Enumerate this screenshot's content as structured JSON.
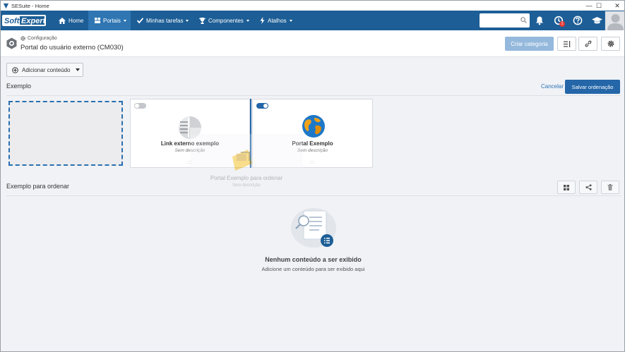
{
  "window": {
    "title": "SESuite - Home",
    "minimize": "—",
    "maximize": "☐",
    "close": "✕"
  },
  "nav": {
    "logo_text_1": "Soft",
    "logo_text_2": "Expert",
    "items": [
      {
        "label": "Home",
        "icon": "home-icon"
      },
      {
        "label": "Portais",
        "icon": "portals-icon"
      },
      {
        "label": "Minhas tarefas",
        "icon": "check-icon"
      },
      {
        "label": "Componentes",
        "icon": "trophy-icon"
      },
      {
        "label": "Atalhos",
        "icon": "bolt-icon"
      }
    ],
    "search_placeholder": "",
    "notification_badge": "1"
  },
  "header": {
    "breadcrumb": "Configuração",
    "title": "Portal do usuário externo (CM030)",
    "create_category": "Criar categoria"
  },
  "content": {
    "add_content": "Adicionar conteúdo",
    "section1_title": "Exemplo",
    "cancel": "Cancelar",
    "save_order": "Salvar ordenação",
    "cards": [
      {
        "title": "Link externo exemplo",
        "desc": "Sem descrição",
        "handle": ":::",
        "enabled": false
      },
      {
        "title": "Portal Exemplo",
        "desc": "Sem descrição",
        "handle": ":::",
        "enabled": true
      }
    ],
    "ghost": {
      "title": "Portal Exemplo para ordenar",
      "desc": "Sem descrição"
    },
    "section2_title": "Exemplo para ordenar",
    "empty_title": "Nenhum conteúdo a ser exibido",
    "empty_sub": "Adicione um conteúdo para ser exibido aqui"
  },
  "colors": {
    "navbar": "#1d5e96",
    "nav_active": "#2f76b3",
    "primary_button": "#2466a8",
    "disabled_button": "#94b9dc",
    "link": "#2e74b5",
    "badge": "#e53935"
  }
}
